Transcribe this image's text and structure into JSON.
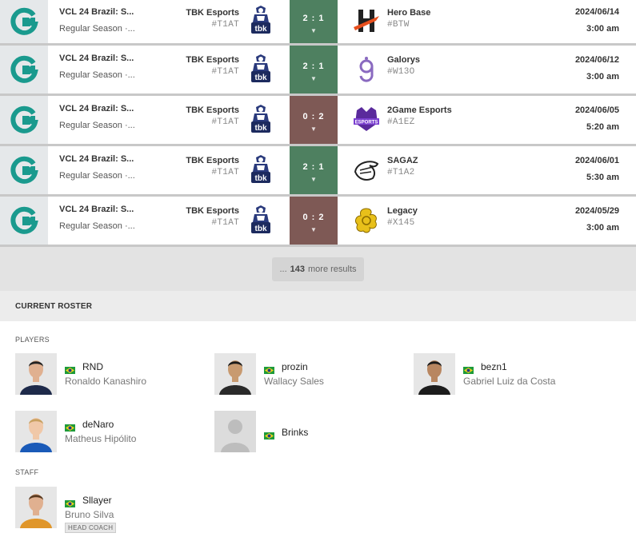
{
  "matches": [
    {
      "event": "VCL 24 Brazil: S...",
      "stage": "Regular Season ·...",
      "team1": "TBK Esports",
      "team1_tag": "#T1AT",
      "score": "2 : 1",
      "result": "win",
      "team2": "Hero Base",
      "team2_tag": "#BTW",
      "team2_logo": "hero-base-logo",
      "date": "2024/06/14",
      "time": "3:00 am"
    },
    {
      "event": "VCL 24 Brazil: S...",
      "stage": "Regular Season ·...",
      "team1": "TBK Esports",
      "team1_tag": "#T1AT",
      "score": "2 : 1",
      "result": "win",
      "team2": "Galorys",
      "team2_tag": "#W13O",
      "team2_logo": "galorys-logo",
      "date": "2024/06/12",
      "time": "3:00 am"
    },
    {
      "event": "VCL 24 Brazil: S...",
      "stage": "Regular Season ·...",
      "team1": "TBK Esports",
      "team1_tag": "#T1AT",
      "score": "0 : 2",
      "result": "loss",
      "team2": "2Game Esports",
      "team2_tag": "#A1EZ",
      "team2_logo": "2game-esports-logo",
      "date": "2024/06/05",
      "time": "5:20 am"
    },
    {
      "event": "VCL 24 Brazil: S...",
      "stage": "Regular Season ·...",
      "team1": "TBK Esports",
      "team1_tag": "#T1AT",
      "score": "2 : 1",
      "result": "win",
      "team2": "SAGAZ",
      "team2_tag": "#T1A2",
      "team2_logo": "sagaz-logo",
      "date": "2024/06/01",
      "time": "5:30 am"
    },
    {
      "event": "VCL 24 Brazil: S...",
      "stage": "Regular Season ·...",
      "team1": "TBK Esports",
      "team1_tag": "#T1AT",
      "score": "0 : 2",
      "result": "loss",
      "team2": "Legacy",
      "team2_tag": "#X145",
      "team2_logo": "legacy-logo",
      "date": "2024/05/29",
      "time": "3:00 am"
    }
  ],
  "more_results": {
    "prefix": "...",
    "count": "143",
    "suffix": "more results"
  },
  "roster": {
    "title": "CURRENT ROSTER",
    "players_label": "PLAYERS",
    "staff_label": "STAFF",
    "players": [
      {
        "handle": "RND",
        "name": "Ronaldo Kanashiro",
        "country": "brazil-flag-icon"
      },
      {
        "handle": "prozin",
        "name": "Wallacy Sales",
        "country": "brazil-flag-icon"
      },
      {
        "handle": "bezn1",
        "name": "Gabriel Luiz da Costa",
        "country": "brazil-flag-icon"
      },
      {
        "handle": "deNaro",
        "name": "Matheus Hipólito",
        "country": "brazil-flag-icon"
      },
      {
        "handle": "Brinks",
        "name": "",
        "country": "brazil-flag-icon"
      }
    ],
    "staff": [
      {
        "handle": "Sllayer",
        "name": "Bruno Silva",
        "role": "HEAD COACH",
        "country": "brazil-flag-icon"
      }
    ]
  },
  "colors": {
    "win": "#4e8060",
    "loss": "#7e5955",
    "event_logo": "#1a9a8e"
  }
}
